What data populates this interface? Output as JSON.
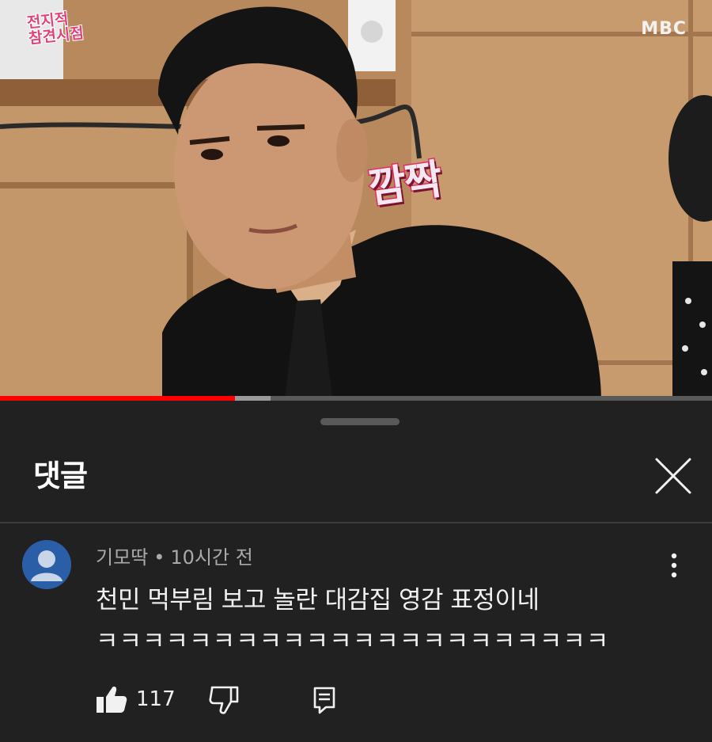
{
  "video": {
    "show_logo_lines": [
      "전지적",
      "참견시점"
    ],
    "broadcaster": "MBC",
    "caption": "깜짝",
    "progress_played_fraction": 0.33,
    "progress_buffered_fraction": 0.38,
    "colors": {
      "progress_played": "#ff0000",
      "progress_buffer": "#9a9a9a"
    }
  },
  "comments_panel": {
    "title": "댓글",
    "close_icon": "close-icon",
    "comments": [
      {
        "author": "기모딱",
        "separator": "•",
        "time": "10시간 전",
        "text_lines": [
          "천민 먹부림 보고 놀란 대감집 영감 표정이네",
          "ㅋㅋㅋㅋㅋㅋㅋㅋㅋㅋㅋㅋㅋㅋㅋㅋㅋㅋㅋㅋㅋㅋ"
        ],
        "likes": "117",
        "icons": {
          "avatar": "default-avatar-icon",
          "more": "more-vert-icon",
          "like": "thumbs-up-icon",
          "dislike": "thumbs-down-icon",
          "reply": "reply-icon"
        }
      }
    ]
  }
}
